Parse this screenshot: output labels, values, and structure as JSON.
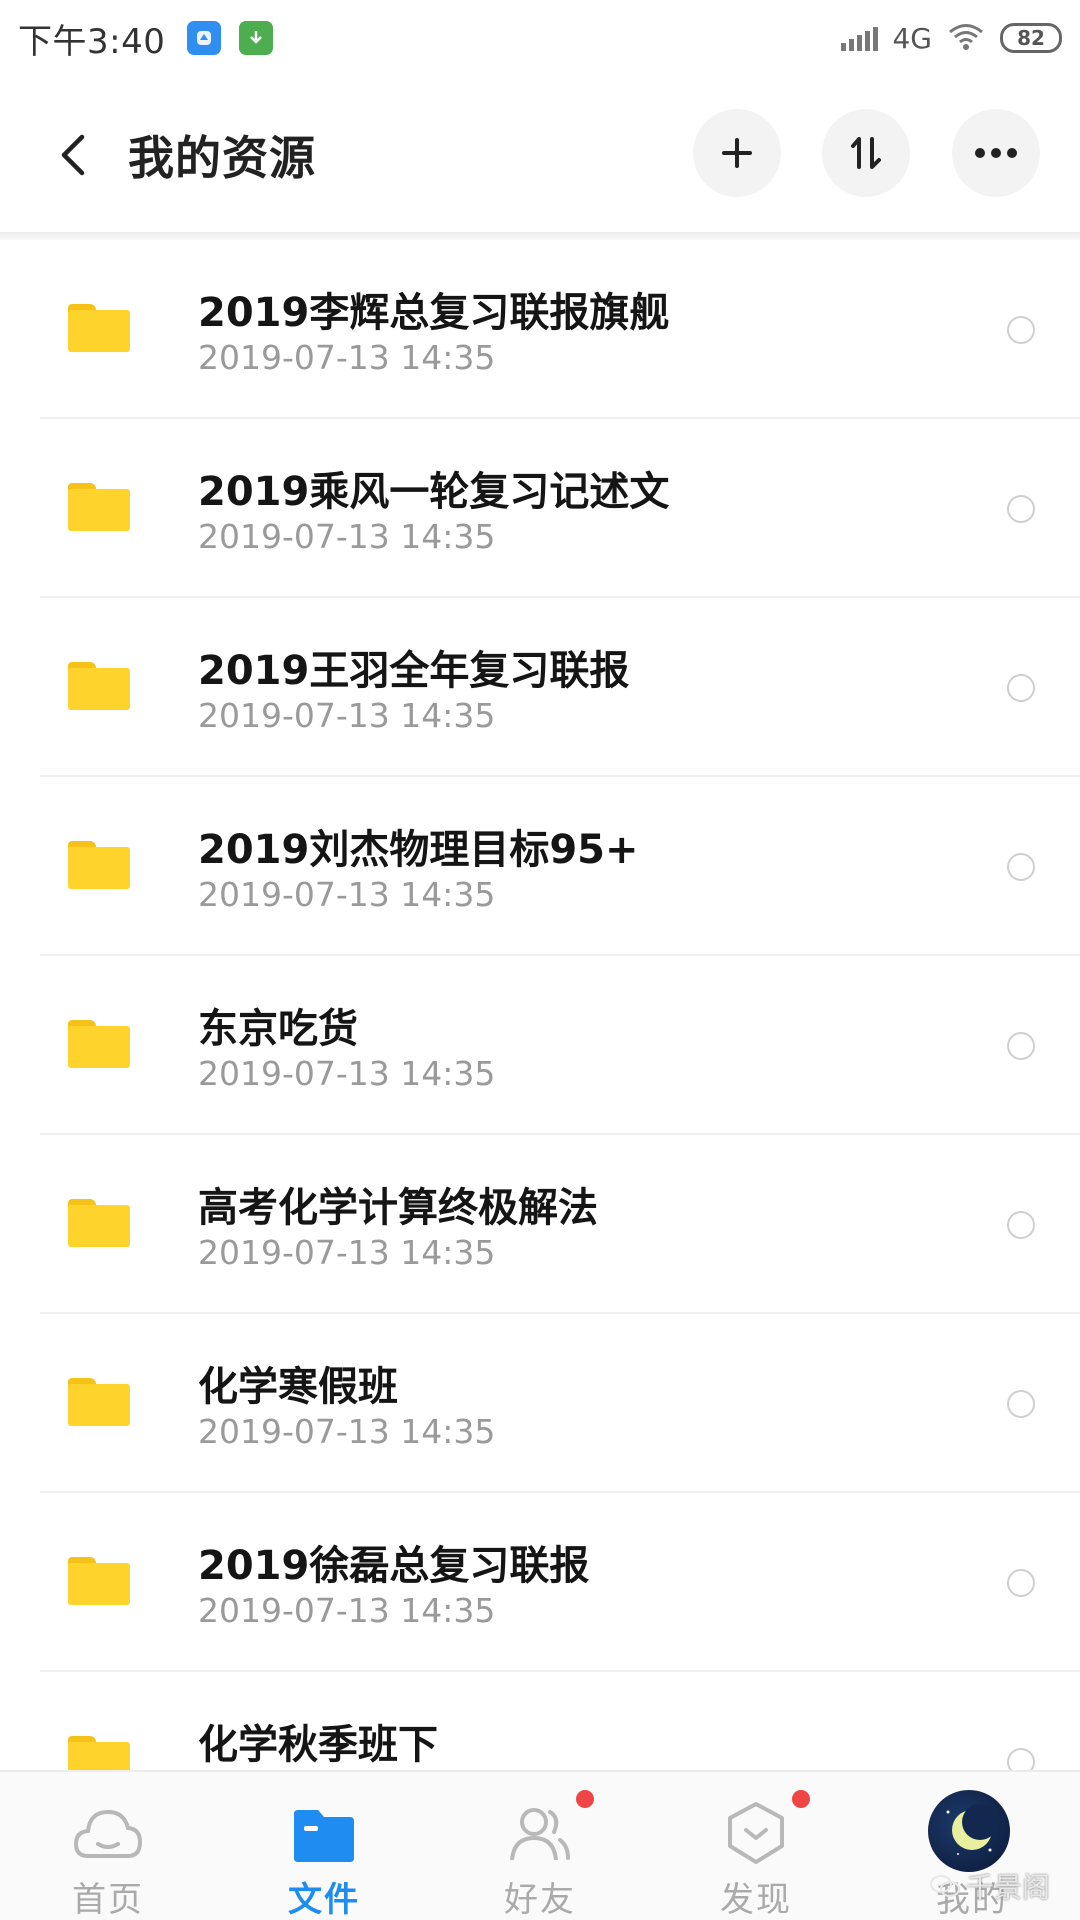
{
  "status_bar": {
    "time": "下午3:40",
    "network": "4G",
    "battery": "82"
  },
  "header": {
    "title": "我的资源"
  },
  "files": [
    {
      "name": "2019李辉总复习联报旗舰",
      "date": "2019-07-13  14:35"
    },
    {
      "name": "2019乘风一轮复习记述文",
      "date": "2019-07-13  14:35"
    },
    {
      "name": "2019王羽全年复习联报",
      "date": "2019-07-13  14:35"
    },
    {
      "name": "2019刘杰物理目标95+",
      "date": "2019-07-13  14:35"
    },
    {
      "name": "东京吃货",
      "date": "2019-07-13  14:35"
    },
    {
      "name": "高考化学计算终极解法",
      "date": "2019-07-13  14:35"
    },
    {
      "name": "化学寒假班",
      "date": "2019-07-13  14:35"
    },
    {
      "name": "2019徐磊总复习联报",
      "date": "2019-07-13  14:35"
    },
    {
      "name": "化学秋季班下",
      "date": ""
    }
  ],
  "bottom_nav": {
    "items": [
      {
        "label": "首页",
        "icon": "cloud-icon"
      },
      {
        "label": "文件",
        "icon": "folder-icon",
        "active": true
      },
      {
        "label": "好友",
        "icon": "friends-icon",
        "badge": true
      },
      {
        "label": "发现",
        "icon": "discover-icon",
        "badge": true
      },
      {
        "label": "我的",
        "icon": "avatar"
      }
    ]
  },
  "watermark": "千景阁",
  "colors": {
    "accent": "#1e8cf0",
    "folder": "#fdd32c",
    "badge": "#f04545"
  }
}
